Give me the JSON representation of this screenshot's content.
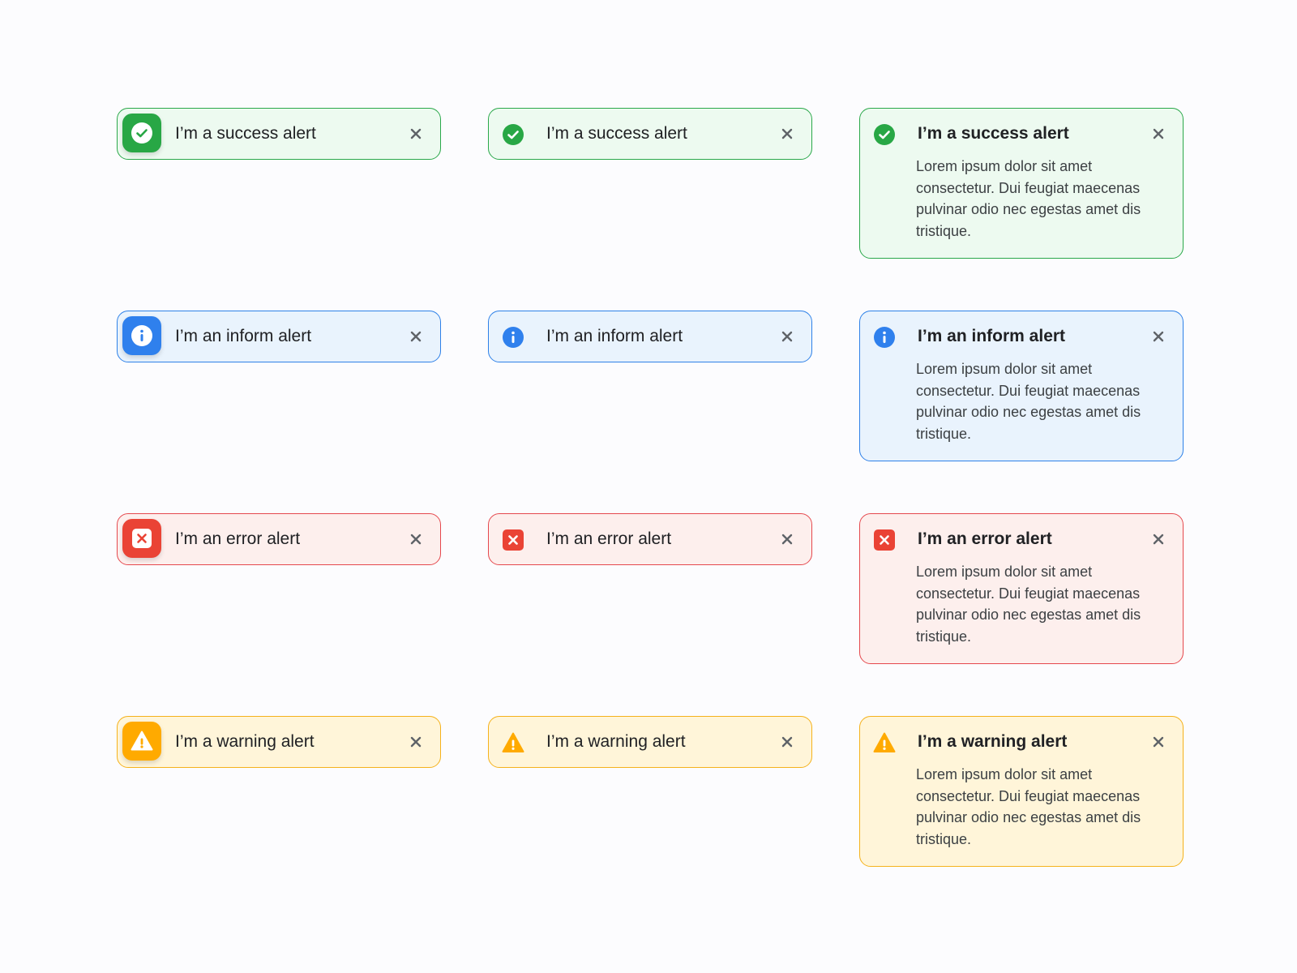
{
  "colors": {
    "success": "#28a745",
    "inform": "#2f80ed",
    "error": "#ea4335",
    "warning": "#ffaa00",
    "success_bg": "#edfaf0",
    "inform_bg": "#e9f3fd",
    "error_bg": "#fdefed",
    "warning_bg": "#fff5d9"
  },
  "alerts": {
    "success": {
      "icon": "check-circle-icon",
      "title": "I’m a success alert",
      "body": "Lorem ipsum dolor sit amet consectetur. Dui feugiat maecenas pulvinar odio nec egestas amet dis tristique."
    },
    "inform": {
      "icon": "info-circle-icon",
      "title": "I’m an inform alert",
      "body": "Lorem ipsum dolor sit amet consectetur. Dui feugiat maecenas pulvinar odio nec egestas amet dis tristique."
    },
    "error": {
      "icon": "error-x-icon",
      "title": "I’m an error alert",
      "body": "Lorem ipsum dolor sit amet consectetur. Dui feugiat maecenas pulvinar odio nec egestas amet dis tristique."
    },
    "warning": {
      "icon": "warning-triangle-icon",
      "title": "I’m a warning alert",
      "body": "Lorem ipsum dolor sit amet consectetur. Dui feugiat maecenas pulvinar odio nec egestas amet dis tristique."
    }
  },
  "close_icon": "close-icon"
}
